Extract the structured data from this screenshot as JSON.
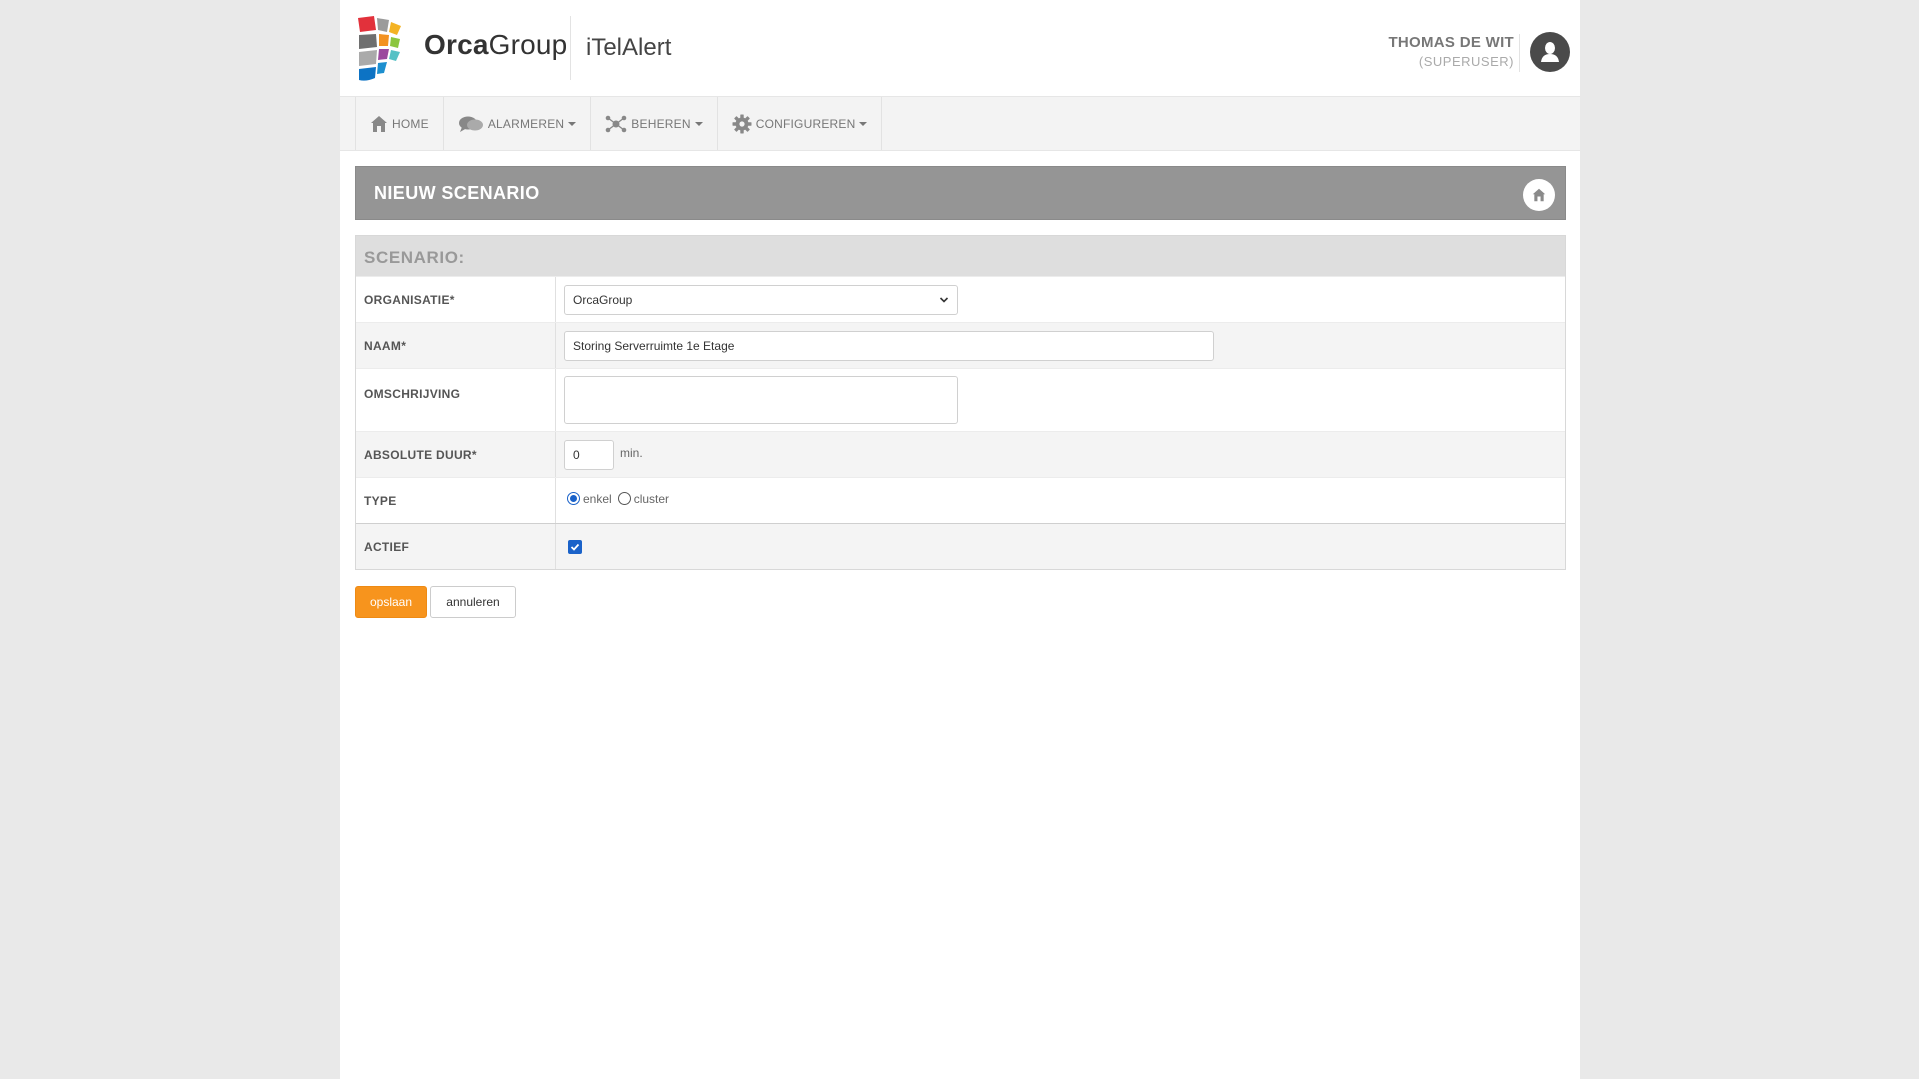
{
  "header": {
    "brand_bold": "Orca",
    "brand_rest": "Group",
    "app_name": "iTelAlert",
    "user_name": "THOMAS DE WIT",
    "user_role": "(SUPERUSER)"
  },
  "nav": {
    "items": [
      {
        "label": "HOME",
        "icon": "home-icon",
        "dropdown": false
      },
      {
        "label": "ALARMEREN",
        "icon": "chat-bubbles-icon",
        "dropdown": true
      },
      {
        "label": "BEHEREN",
        "icon": "network-icon",
        "dropdown": true
      },
      {
        "label": "CONFIGUREREN",
        "icon": "gear-icon",
        "dropdown": true
      }
    ]
  },
  "page": {
    "title": "NIEUW SCENARIO",
    "home_icon": "home-icon"
  },
  "form": {
    "section_title": "SCENARIO:",
    "organisatie": {
      "label": "ORGANISATIE*",
      "value": "OrcaGroup"
    },
    "naam": {
      "label": "NAAM*",
      "value": "Storing Serverruimte 1e Etage"
    },
    "omschrijving": {
      "label": "OMSCHRIJVING",
      "value": ""
    },
    "duur": {
      "label": "ABSOLUTE DUUR*",
      "value": "0",
      "unit": "min."
    },
    "type": {
      "label": "TYPE",
      "options": [
        "enkel",
        "cluster"
      ],
      "selected": "enkel"
    },
    "actief": {
      "label": "ACTIEF",
      "checked": true
    }
  },
  "buttons": {
    "save": "opslaan",
    "cancel": "annuleren"
  },
  "colors": {
    "accent": "#f7941d",
    "title_bar": "#959595",
    "check_blue": "#1a62c9"
  }
}
